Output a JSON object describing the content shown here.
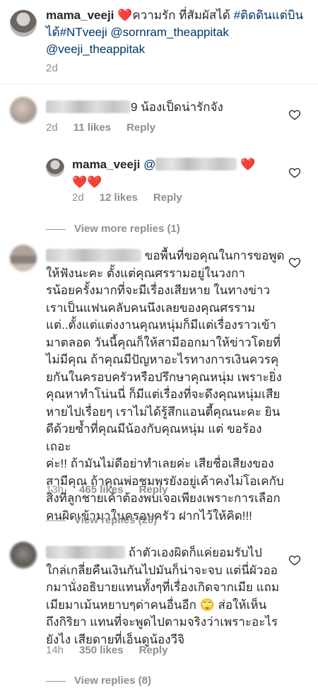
{
  "caption": {
    "username": "mama_veeji",
    "heart": "❤️",
    "text1": "ความรัก ที่สัมผัสได้ ",
    "hashtag1": "#ติดดินแต่บินได้",
    "hashtag2": "#NTveeji",
    "mention1": "@sornram_theappitak",
    "mention2": "@veeji_theappitak",
    "time": "2d"
  },
  "comment1": {
    "text": "9 น้องเป็ดน่ารักจัง",
    "time": "2d",
    "likes": "11 likes",
    "reply": "Reply"
  },
  "reply1": {
    "username": "mama_veeji",
    "mention": "@",
    "hearts_line1": "❤️",
    "hearts_line2": "❤️❤️",
    "time": "2d",
    "likes": "12 likes",
    "reply": "Reply",
    "view_more": "View more replies (1)"
  },
  "comment2": {
    "lines": [
      "ขอพื้นที่ขอคุณในการขอพูด",
      "ให้ฟังนะคะ ตั้งแต่คุณศรรามอยู่ในวงกา",
      "รน้อยครั้งมากที่จะมีเรื่องเสียหาย ในทางข่าว",
      "เราเป็นแฟนคลับคนนึงเลยของคุณศรราม",
      "แต่..ตั้งแต่แต่งงานคุณหนุ่มก็มีแต่เรื่องราวเข้า",
      "มาตลอด วันนี้คุณก็ให้สามีออกมาให้ข่าวโดยที่",
      "ไม่มีคุณ ถ้าคุณมีปัญหาอะไรทางการเงินควรคุ",
      "ยกันในครอบครัวหรือปรึกษาคุณหนุ่ม เพราะยิ่ง",
      "คุณหาทำโน่นนี่ ก็มีแต่เรื่องที่จะดึงคุณหนุ่มเสีย",
      "หายไปเรื่อยๆ เราไม่ได้รู้สึกแอนตี้คุณนะคะ ยิน",
      "ดีด้วยซ้ำที่คุณมีน้องกับคุณหนุ่ม แต่ ขอร้องเถอะ",
      "ค่ะ!! ถ้ามันไม่ดีอย่าทำเลยค่ะ เสียชื่อเสียงของ",
      "สามีคุณ ถ้าคุณพ่อชุมพรยังอยู่เค้าคงไม่โอเคกับ",
      "สิ่งที่ลูกชายเค้าต้องพบเจอเพียงเพราะการเลือก",
      "คนผิดเข้ามาในครอบครัว ฝากไว้ให้คิด!!!"
    ],
    "time": "13h",
    "likes": "465 likes",
    "reply": "Reply",
    "view_replies": "View replies (26)"
  },
  "comment3": {
    "lines": [
      "ถ้าตัวเองผิดก็แค่ยอมรับไป",
      "ใกล่เกลี่ยคืนเงินกันไปมันก็น่าจะจบ แต่นี่ผัวออ",
      "กมานั่งอธิบายแทนทั้งๆที่เรื่องเกิดจากเมีย แถม",
      "เมียมาเม้นหยาบๆด่าคนอื่นอีก 🙄 ส่อให้เห็น",
      "ถึงกิริยา แทนที่จะพูดไปตามจริงว่าเพราะอะไร",
      "ยังไง เสียดายที่เอ็นดูน้องวีจิ"
    ],
    "time": "14h",
    "likes": "350 likes",
    "reply": "Reply",
    "view_replies": "View replies (8)"
  }
}
